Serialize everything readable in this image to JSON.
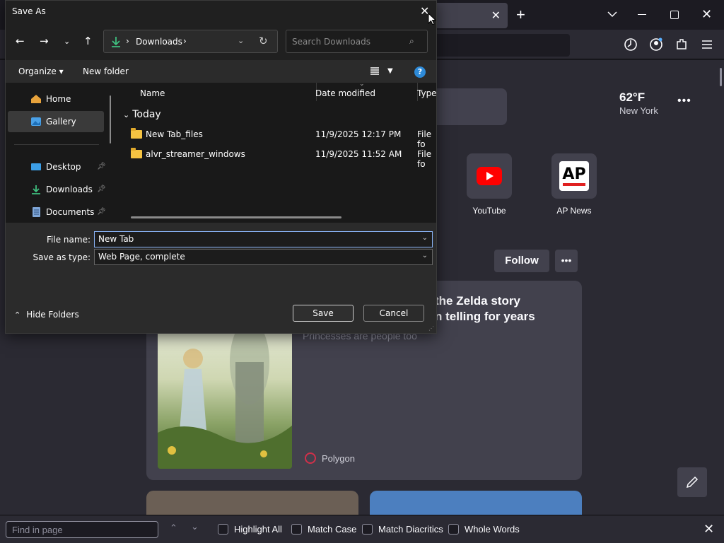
{
  "browser": {
    "weather": {
      "temp": "62°F",
      "city": "New York"
    },
    "shortcuts": [
      {
        "name": "YouTube"
      },
      {
        "name": "AP News",
        "logo_text": "AP"
      }
    ],
    "follow_label": "Follow",
    "story": {
      "title": "the Zelda story\nn telling for years",
      "subtitle": "Princesses are people too",
      "source": "Polygon"
    }
  },
  "findbar": {
    "placeholder": "Find in page",
    "options": [
      "Highlight All",
      "Match Case",
      "Match Diacritics",
      "Whole Words"
    ]
  },
  "dialog": {
    "title": "Save As",
    "address": {
      "location": "Downloads"
    },
    "search_placeholder": "Search Downloads",
    "commands": {
      "organize": "Organize",
      "new_folder": "New folder"
    },
    "nav_items": [
      {
        "label": "Home"
      },
      {
        "label": "Gallery"
      },
      {
        "label": "Desktop"
      },
      {
        "label": "Downloads"
      },
      {
        "label": "Documents"
      }
    ],
    "columns": [
      "Name",
      "Date modified",
      "Type"
    ],
    "group": "Today",
    "files": [
      {
        "name": "New Tab_files",
        "date": "11/9/2025 12:17 PM",
        "type": "File fo"
      },
      {
        "name": "alvr_streamer_windows",
        "date": "11/9/2025 11:52 AM",
        "type": "File fo"
      }
    ],
    "file_name_label": "File name:",
    "file_name_value": "New Tab",
    "save_type_label": "Save as type:",
    "save_type_value": "Web Page, complete",
    "hide_folders": "Hide Folders",
    "save_label": "Save",
    "cancel_label": "Cancel"
  },
  "colors": {
    "accent": "#2d8ad8",
    "folder": "#f5c342",
    "youtube": "#ff0000"
  }
}
